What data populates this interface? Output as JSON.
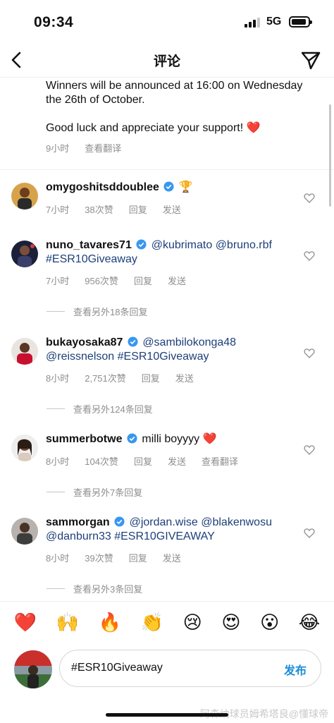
{
  "status": {
    "time": "09:34",
    "network": "5G"
  },
  "nav": {
    "title": "评论"
  },
  "caption": {
    "line1": "Winners will be announced at 16:00 on Wednesday the 26th of October.",
    "line2": "Good luck and appreciate your support! ❤️",
    "time": "9小时",
    "translate": "查看翻译"
  },
  "comments": [
    {
      "username": "omygoshitsddoublee",
      "verified": true,
      "text": "🏆",
      "time": "7小时",
      "likes": "38次赞",
      "reply": "回复",
      "send": "发送",
      "more_replies": ""
    },
    {
      "username": "nuno_tavares71",
      "verified": true,
      "text": "@kubrimato @bruno.rbf #ESR10Giveaway",
      "time": "7小时",
      "likes": "956次赞",
      "reply": "回复",
      "send": "发送",
      "more_replies": "查看另外18条回复"
    },
    {
      "username": "bukayosaka87",
      "verified": true,
      "text": "@sambilokonga48 @reissnelson #ESR10Giveaway",
      "time": "8小时",
      "likes": "2,751次赞",
      "reply": "回复",
      "send": "发送",
      "more_replies": "查看另外124条回复"
    },
    {
      "username": "summerbotwe",
      "verified": true,
      "text": "milli boyyyy ❤️",
      "time": "8小时",
      "likes": "104次赞",
      "reply": "回复",
      "send": "发送",
      "translate": "查看翻译",
      "more_replies": "查看另外7条回复"
    },
    {
      "username": "sammorgan",
      "verified": true,
      "text": "@jordan.wise @blakenwosu @danburn33 #ESR10GIVEAWAY",
      "time": "8小时",
      "likes": "39次赞",
      "reply": "回复",
      "send": "发送",
      "more_replies": "查看另外3条回复"
    }
  ],
  "emojis": [
    "❤️",
    "🙌",
    "🔥",
    "👏",
    "😢",
    "😍",
    "😮",
    "😂"
  ],
  "input": {
    "value": "#ESR10Giveaway",
    "post": "发布"
  },
  "watermark": "阿森纳球员姆希塔良@懂球帝",
  "colors": {
    "link": "#1d3f7a",
    "post": "#1a8cd8",
    "verified": "#3897f0",
    "meta": "#8e8e8e"
  }
}
